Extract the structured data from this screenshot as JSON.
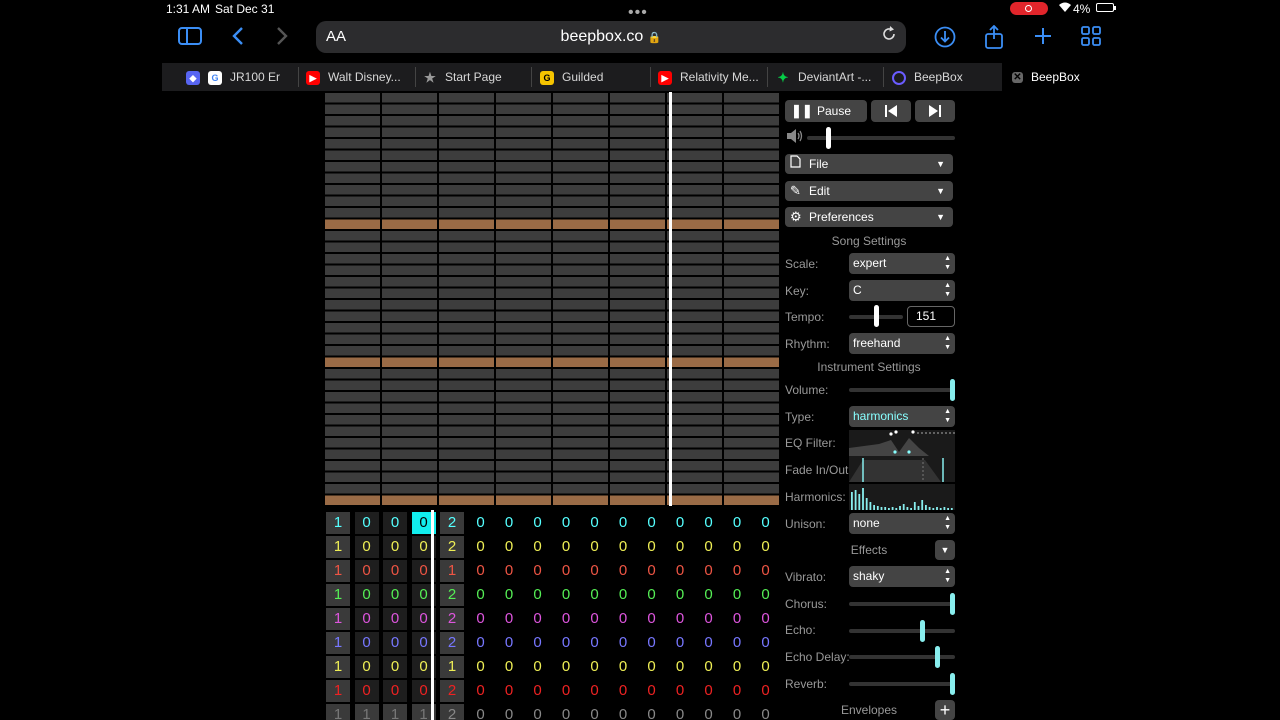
{
  "status": {
    "time": "1:31 AM",
    "date": "Sat Dec 31",
    "battery": "4%"
  },
  "toolbar": {
    "aa": "AA",
    "url": "beepbox.co"
  },
  "tabs": [
    {
      "label": "JR100 Er",
      "favicon": "google-icon",
      "color": "#ffffff"
    },
    {
      "label": "Walt Disney...",
      "favicon": "youtube-icon",
      "color": "#ff0000"
    },
    {
      "label": "Start Page",
      "favicon": "star-icon",
      "color": "#888888"
    },
    {
      "label": "Guilded",
      "favicon": "guilded-icon",
      "color": "#f5c400"
    },
    {
      "label": "Relativity Me...",
      "favicon": "youtube-icon",
      "color": "#ff0000"
    },
    {
      "label": "DeviantArt -...",
      "favicon": "deviantart-icon",
      "color": "#05cc47"
    },
    {
      "label": "BeepBox",
      "favicon": "beepbox-icon",
      "color": "#6a5cff"
    },
    {
      "label": "BeepBox",
      "favicon": "close-icon",
      "color": "#888888"
    }
  ],
  "colors": {
    "accent": "#3b8ef5",
    "highlight_row": "#9a6b46",
    "playhead": "#ffffff",
    "slider": "#8ee"
  },
  "panel": {
    "pause": "Pause",
    "file": "File",
    "edit": "Edit",
    "preferences": "Preferences",
    "song_settings": "Song Settings",
    "scale_label": "Scale:",
    "scale_value": "expert",
    "key_label": "Key:",
    "key_value": "C",
    "tempo_label": "Tempo:",
    "tempo_value": "151",
    "rhythm_label": "Rhythm:",
    "rhythm_value": "freehand",
    "instrument_settings": "Instrument Settings",
    "volume_label": "Volume:",
    "type_label": "Type:",
    "type_value": "harmonics",
    "eq_label": "EQ Filter:",
    "fade_label": "Fade In/Out:",
    "harmonics_label": "Harmonics:",
    "unison_label": "Unison:",
    "unison_value": "none",
    "effects": "Effects",
    "vibrato_label": "Vibrato:",
    "vibrato_value": "shaky",
    "chorus_label": "Chorus:",
    "echo_label": "Echo:",
    "echo_delay_label": "Echo Delay:",
    "reverb_label": "Reverb:",
    "envelopes": "Envelopes"
  },
  "sliders": {
    "master_volume": 0.13,
    "tempo": 0.5,
    "volume": 1.0,
    "chorus": 1.0,
    "echo": 0.7,
    "echo_delay": 0.85,
    "reverb": 1.0
  },
  "pattern": {
    "channel_colors": [
      "#5ff",
      "#ee5",
      "#e54",
      "#5e5",
      "#d5d",
      "#77f",
      "#ee5",
      "#e22",
      "#888"
    ],
    "rows": [
      [
        "1",
        "0",
        "0",
        "0",
        "2",
        "0",
        "0",
        "0",
        "0",
        "0",
        "0",
        "0",
        "0",
        "0",
        "0",
        "0"
      ],
      [
        "1",
        "0",
        "0",
        "0",
        "2",
        "0",
        "0",
        "0",
        "0",
        "0",
        "0",
        "0",
        "0",
        "0",
        "0",
        "0"
      ],
      [
        "1",
        "0",
        "0",
        "0",
        "1",
        "0",
        "0",
        "0",
        "0",
        "0",
        "0",
        "0",
        "0",
        "0",
        "0",
        "0"
      ],
      [
        "1",
        "0",
        "0",
        "0",
        "2",
        "0",
        "0",
        "0",
        "0",
        "0",
        "0",
        "0",
        "0",
        "0",
        "0",
        "0"
      ],
      [
        "1",
        "0",
        "0",
        "0",
        "2",
        "0",
        "0",
        "0",
        "0",
        "0",
        "0",
        "0",
        "0",
        "0",
        "0",
        "0"
      ],
      [
        "1",
        "0",
        "0",
        "0",
        "2",
        "0",
        "0",
        "0",
        "0",
        "0",
        "0",
        "0",
        "0",
        "0",
        "0",
        "0"
      ],
      [
        "1",
        "0",
        "0",
        "0",
        "1",
        "0",
        "0",
        "0",
        "0",
        "0",
        "0",
        "0",
        "0",
        "0",
        "0",
        "0"
      ],
      [
        "1",
        "0",
        "0",
        "0",
        "2",
        "0",
        "0",
        "0",
        "0",
        "0",
        "0",
        "0",
        "0",
        "0",
        "0",
        "0"
      ],
      [
        "1",
        "1",
        "1",
        "1",
        "2",
        "0",
        "0",
        "0",
        "0",
        "0",
        "0",
        "0",
        "0",
        "0",
        "0",
        "0"
      ]
    ],
    "selected_cell_text": "0"
  }
}
